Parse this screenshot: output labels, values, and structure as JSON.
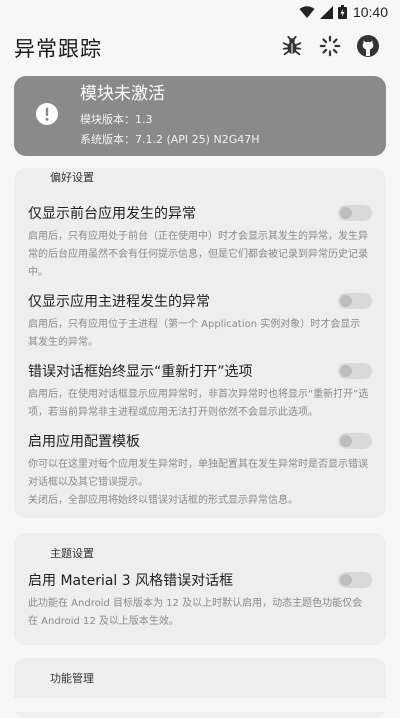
{
  "status_bar": {
    "time": "10:40",
    "icons": [
      "wifi-icon",
      "signal-icon",
      "battery-icon"
    ]
  },
  "app_bar": {
    "title": "异常跟踪",
    "actions": [
      "bug-icon",
      "loading-icon",
      "github-icon"
    ]
  },
  "module_status": {
    "title": "模块未激活",
    "module_version": "模块版本：1.3",
    "system_version": "系统版本：7.1.2 (API 25) N2G47H",
    "icon": "exclamation-icon",
    "background": "#8a8a8a"
  },
  "preferences": {
    "section_title": "偏好设置",
    "items": [
      {
        "label": "仅显示前台应用发生的异常",
        "desc": "启用后，只有应用处于前台（正在使用中）时才会显示其发生的异常，发生异常的后台应用虽然不会有任何提示信息，但是它们都会被记录到异常历史记录中。",
        "enabled": false
      },
      {
        "label": "仅显示应用主进程发生的异常",
        "desc": "启用后，只有应用位于主进程（第一个 Application 实例对象）时才会显示其发生的异常。",
        "enabled": false
      },
      {
        "label": "错误对话框始终显示“重新打开”选项",
        "desc": "启用后，在使用对话框显示应用异常时，非首次异常时也将显示“重新打开”选项，若当前异常非主进程或应用无法打开则依然不会显示此选项。",
        "enabled": false
      },
      {
        "label": "启用应用配置模板",
        "desc_lines": [
          "你可以在这里对每个应用发生异常时，单独配置其在发生异常时是否显示错误对话框以及其它错误提示。",
          "关闭后，全部应用将始终以错误对话框的形式显示异常信息。"
        ],
        "enabled": false
      }
    ]
  },
  "theme": {
    "section_title": "主题设置",
    "item": {
      "label": "启用 Material 3 风格错误对话框",
      "desc": "此功能在 Android 目标版本为 12 及以上时默认启用，动态主题色功能仅会在 Android 12 及以上版本生效。",
      "enabled": false
    }
  },
  "features": {
    "section_title": "功能管理"
  }
}
